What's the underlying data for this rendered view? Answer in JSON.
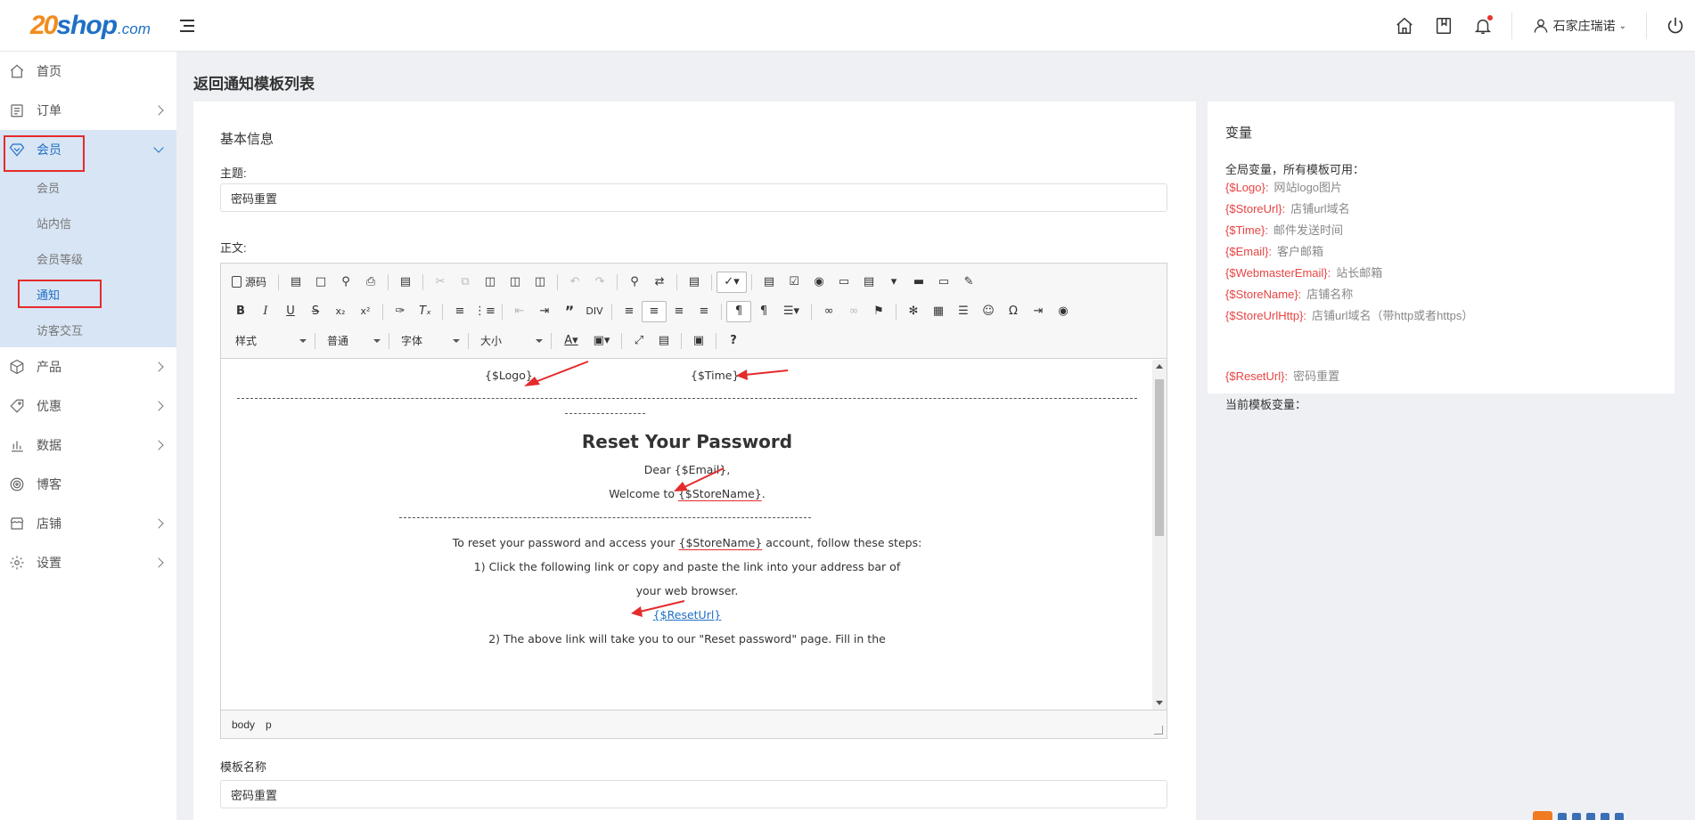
{
  "logo": {
    "num": "20",
    "shop": "shop",
    "com": ".com"
  },
  "header": {
    "user_name": "石家庄瑞诺",
    "icons": [
      "home-icon",
      "bookmark-icon",
      "bell-icon",
      "user-icon",
      "power-icon"
    ]
  },
  "sidebar": {
    "items": [
      {
        "label": "首页",
        "icon": "home-icon"
      },
      {
        "label": "订单",
        "icon": "order-icon"
      },
      {
        "label": "会员",
        "icon": "member-icon"
      },
      {
        "label": "产品",
        "icon": "product-icon"
      },
      {
        "label": "优惠",
        "icon": "coupon-icon"
      },
      {
        "label": "数据",
        "icon": "chart-icon"
      },
      {
        "label": "博客",
        "icon": "blog-icon"
      },
      {
        "label": "店铺",
        "icon": "store-icon"
      },
      {
        "label": "设置",
        "icon": "settings-icon"
      }
    ],
    "sub_items": [
      "会员",
      "站内信",
      "会员等级",
      "通知",
      "访客交互"
    ]
  },
  "page": {
    "back_title": "返回通知模板列表"
  },
  "form": {
    "section_title": "基本信息",
    "subject_label": "主题:",
    "subject_value": "密码重置",
    "body_label": "正文:",
    "template_name_label": "模板名称",
    "template_name_value": "密码重置"
  },
  "editor": {
    "source_label": "源码",
    "selects": [
      "样式",
      "普通",
      "字体",
      "大小"
    ],
    "status_path": [
      "body",
      "p"
    ],
    "content": {
      "logo_var": "{$Logo}",
      "time_var": "{$Time}",
      "heading": "Reset Your Password",
      "dear": "Dear {$Email},",
      "welcome_pre": "Welcome to ",
      "store_name": "{$StoreName}",
      "welcome_post": ".",
      "reset_pre": "To reset your password and access your ",
      "reset_post": " account, follow these steps:",
      "step1a": "1)  Click the following link or copy and paste the link into your address bar of",
      "step1b": "your web browser.",
      "reset_url": "{$ResetUrl}",
      "step2": "2)  The above link will take you to our \"Reset password\" page. Fill in the"
    }
  },
  "variables": {
    "title": "变量",
    "global_head": "全局变量，所有模板可用：",
    "global": [
      {
        "key": "{$Logo}:",
        "desc": "网站logo图片"
      },
      {
        "key": "{$StoreUrl}:",
        "desc": "店铺url域名"
      },
      {
        "key": "{$Time}:",
        "desc": "邮件发送时间"
      },
      {
        "key": "{$Email}:",
        "desc": "客户邮箱"
      },
      {
        "key": "{$WebmasterEmail}:",
        "desc": "站长邮箱"
      },
      {
        "key": "{$StoreName}:",
        "desc": "店铺名称"
      },
      {
        "key": "{$StoreUrlHttp}:",
        "desc": "店铺url域名（带http或者https）"
      }
    ],
    "current_head": "当前模板变量：",
    "current": [
      {
        "key": "{$ResetUrl}:",
        "desc": "密码重置"
      }
    ]
  },
  "colors": {
    "accent": "#1f6fc5",
    "brand_orange": "#f28c1e",
    "annotation_red": "#e52b2b",
    "var_red": "#e84444"
  }
}
